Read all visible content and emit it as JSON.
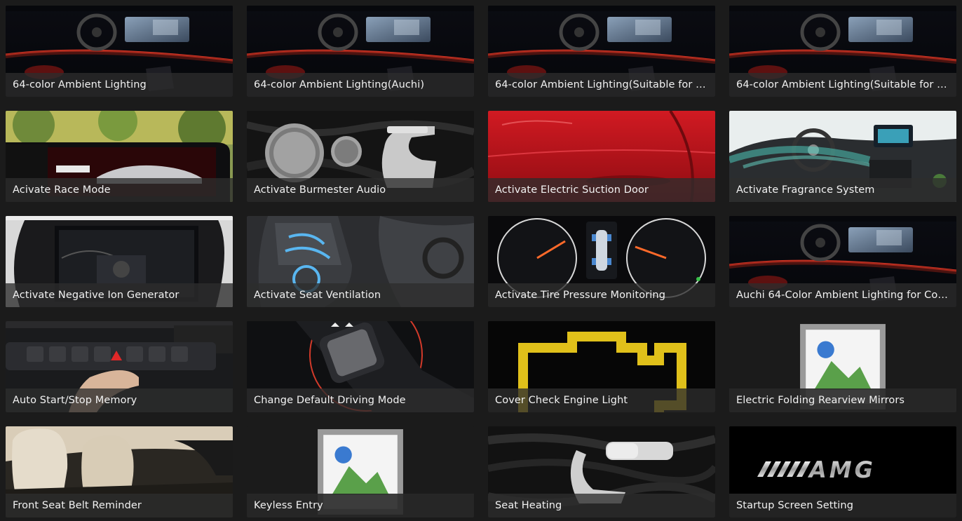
{
  "features": [
    {
      "label": "64-color Ambient Lighting",
      "image": "ambient-dashboard"
    },
    {
      "label": "64-color Ambient Lighting(Auchi)",
      "image": "ambient-dashboard"
    },
    {
      "label": "64-color Ambient Lighting(Suitable for a...",
      "image": "ambient-dashboard"
    },
    {
      "label": "64-color Ambient Lighting(Suitable for H...",
      "image": "ambient-dashboard"
    },
    {
      "label": "Acivate Race Mode",
      "image": "race-mode-screen"
    },
    {
      "label": "Activate Burmester Audio",
      "image": "burmester-speakers"
    },
    {
      "label": "Activate Electric Suction Door",
      "image": "red-door"
    },
    {
      "label": "Activate Fragrance System",
      "image": "fragrance-interior"
    },
    {
      "label": "Activate Negative Ion Generator",
      "image": "climate-screen"
    },
    {
      "label": "Activate Seat Ventilation",
      "image": "ventilated-seat"
    },
    {
      "label": "Activate Tire Pressure Monitoring",
      "image": "instrument-cluster"
    },
    {
      "label": "Auchi 64-Color Ambient Lighting for Com...",
      "image": "ambient-dashboard"
    },
    {
      "label": "Auto Start/Stop Memory",
      "image": "button-panel"
    },
    {
      "label": "Change Default Driving Mode",
      "image": "dynamic-select"
    },
    {
      "label": "Cover Check Engine Light",
      "image": "engine-light"
    },
    {
      "label": "Electric Folding Rearview Mirrors",
      "image": "broken-image"
    },
    {
      "label": "Front Seat Belt Reminder",
      "image": "front-seats"
    },
    {
      "label": "Keyless Entry",
      "image": "broken-image"
    },
    {
      "label": "Seat Heating",
      "image": "seat-controls"
    },
    {
      "label": "Startup Screen Setting",
      "image": "amg-logo"
    }
  ],
  "logo_text": "AMG"
}
